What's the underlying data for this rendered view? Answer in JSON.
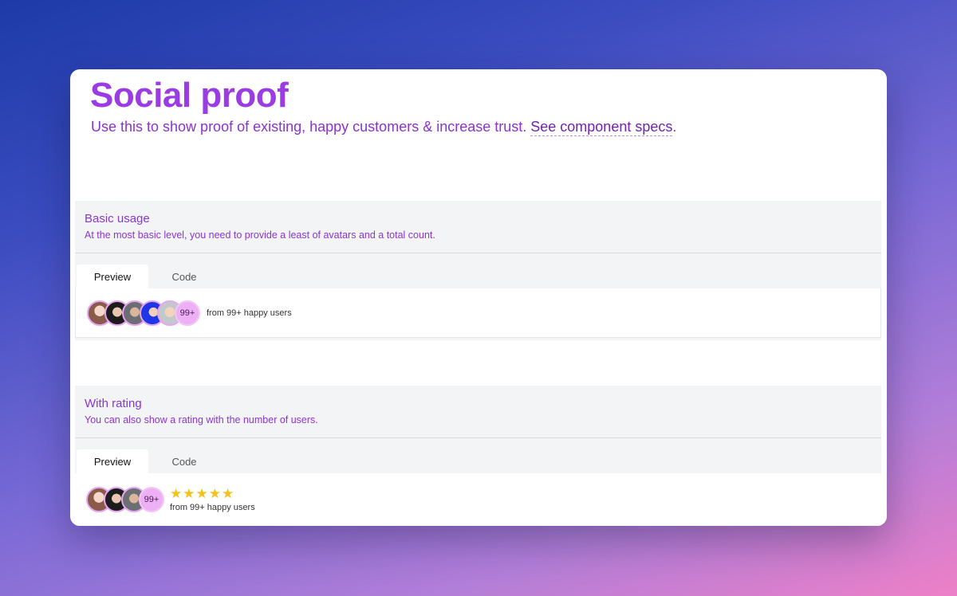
{
  "header": {
    "title": "Social proof",
    "subtitle": "Use this to show proof of existing, happy customers & increase trust. ",
    "link_label": "See component specs",
    "link_suffix": "."
  },
  "sections": [
    {
      "title": "Basic usage",
      "description": "At the most basic level, you need to provide a least of avatars and a total count.",
      "tabs": [
        "Preview",
        "Code"
      ],
      "active_tab": "Preview",
      "preview": {
        "avatars": [
          "avatar-1",
          "avatar-2",
          "avatar-3",
          "avatar-4",
          "avatar-5"
        ],
        "count_badge": "99+",
        "users_text": "from 99+ happy users"
      }
    },
    {
      "title": "With rating",
      "description": "You can also show a rating with the number of users.",
      "tabs": [
        "Preview",
        "Code"
      ],
      "active_tab": "Preview",
      "preview": {
        "avatars": [
          "avatar-1",
          "avatar-2",
          "avatar-3"
        ],
        "count_badge": "99+",
        "rating_stars": 5,
        "rating_max": 5,
        "users_text": "from 99+ happy users"
      }
    }
  ],
  "colors": {
    "accent": "#9a3be4",
    "star": "#f4c21a",
    "badge": "#eeb0f4"
  },
  "icons": {
    "star": "star-icon"
  }
}
